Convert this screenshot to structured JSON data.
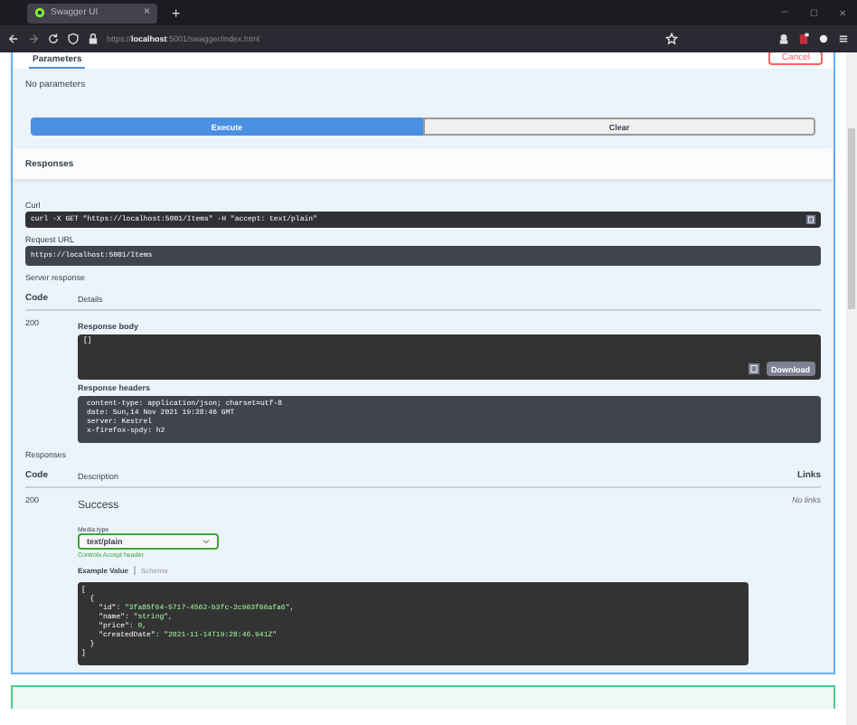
{
  "browser": {
    "tab_title": "Swagger UI",
    "tab_close": "×",
    "new_tab": "+",
    "url_prefix": "https://",
    "url_host": "localhost",
    "url_rest": ":5001/swagger/index.html",
    "window_controls": [
      "─",
      "☐",
      "✕"
    ]
  },
  "parameters": {
    "tab": "Parameters",
    "cancel": "Cancel",
    "note": "No parameters"
  },
  "buttons": [
    {
      "label": "Execute",
      "kind": "primary"
    },
    {
      "label": "Clear",
      "kind": "secondary"
    }
  ],
  "responses_title": "Responses",
  "curl": {
    "label": "Curl",
    "command": "curl -X GET \"https://localhost:5001/Items\" -H  \"accept: text/plain\""
  },
  "request_url": {
    "label": "Request URL",
    "value": "https://localhost:5001/Items"
  },
  "server_response": {
    "label": "Server response",
    "columns": [
      "Code",
      "Details"
    ],
    "code": "200",
    "body_label": "Response body",
    "body": "[]",
    "download": "Download",
    "headers_label": "Response headers",
    "headers": [
      "content-type: application/json; charset=utf-8",
      "date: Sun,14 Nov 2021 19:28:46 GMT",
      "server: Kestrel",
      "x-firefox-spdy: h2"
    ]
  },
  "responses": {
    "title": "Responses",
    "columns": [
      "Code",
      "Description",
      "Links"
    ],
    "rows": [
      {
        "code": "200",
        "description": "Success",
        "links": "No links",
        "media_type_label": "Media type",
        "media_type": "text/plain",
        "controls_note": "Controls Accept header",
        "example_tabs": [
          {
            "label": "Example Value",
            "selected": true
          },
          {
            "label": "Schema",
            "selected": false
          }
        ],
        "example": [
          {
            "text": "["
          },
          {
            "text": "  {"
          },
          {
            "key": "    \"id\"",
            "value": ": \"3fa85f64-5717-4562-b3fc-2c963f66afa6\","
          },
          {
            "key": "    \"name\"",
            "value": ": \"string\","
          },
          {
            "key": "    \"price\"",
            "value": ": 0,"
          },
          {
            "key": "    \"createdDate\"",
            "value": ": \"2021-11-14T19:28:46.941Z\""
          },
          {
            "text": "  }"
          },
          {
            "text": "]"
          }
        ]
      }
    ]
  }
}
